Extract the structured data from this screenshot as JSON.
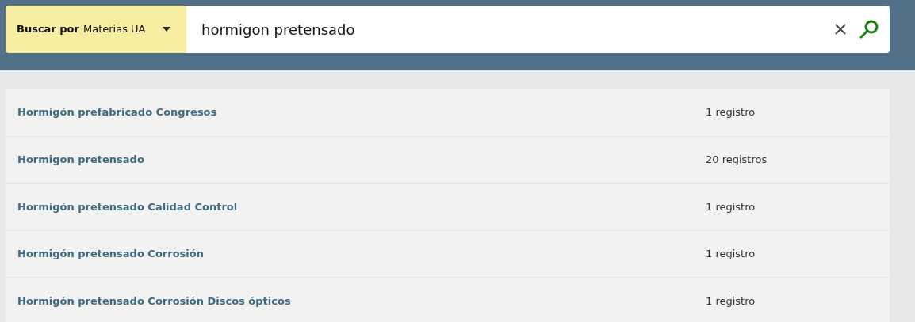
{
  "search": {
    "scope_label": "Buscar por",
    "scope_value": "Materias UA",
    "query": "hormigon pretensado"
  },
  "results": [
    {
      "title": "Hormigón prefabricado Congresos",
      "count": "1 registro"
    },
    {
      "title": "Hormigon pretensado",
      "count": "20 registros"
    },
    {
      "title": "Hormigón pretensado Calidad Control",
      "count": "1 registro"
    },
    {
      "title": "Hormigón pretensado Corrosión",
      "count": "1 registro"
    },
    {
      "title": "Hormigón pretensado Corrosión Discos ópticos",
      "count": "1 registro"
    }
  ]
}
